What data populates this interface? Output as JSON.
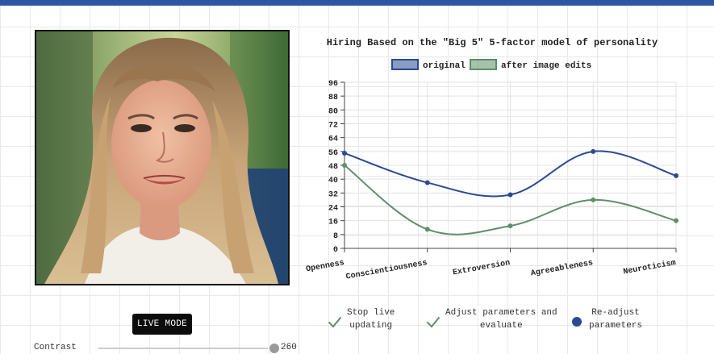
{
  "page": {
    "accent_color": "#2d56a3"
  },
  "photo": {
    "subject_icon": "portrait-photo"
  },
  "chart_data": {
    "type": "line",
    "title": "Hiring Based on the \"Big 5\" 5-factor model of personality",
    "categories": [
      "Openness",
      "Conscientiousness",
      "Extroversion",
      "Agreeableness",
      "Neuroticism"
    ],
    "series": [
      {
        "name": "original",
        "values": [
          55,
          38,
          31,
          56,
          42
        ],
        "color": "#2b4a94"
      },
      {
        "name": "after image edits",
        "values": [
          48,
          11,
          13,
          28,
          16
        ],
        "color": "#5e8f68"
      }
    ],
    "yticks": [
      0,
      8,
      16,
      24,
      32,
      40,
      48,
      56,
      64,
      72,
      80,
      88,
      96
    ],
    "ylim": [
      0,
      96
    ],
    "grid": true,
    "legend_position": "top-center",
    "xlabel": "",
    "ylabel": ""
  },
  "controls": {
    "live_mode_label": "LIVE MODE",
    "actions": [
      {
        "icon": "check-icon",
        "label_line1": "Stop live",
        "label_line2": "updating"
      },
      {
        "icon": "check-icon",
        "label_line1": "Adjust parameters and",
        "label_line2": "evaluate"
      },
      {
        "icon": "dot-icon",
        "label_line1": "Re-adjust",
        "label_line2": "parameters"
      }
    ],
    "contrast": {
      "label": "Contrast",
      "value": "260"
    }
  }
}
